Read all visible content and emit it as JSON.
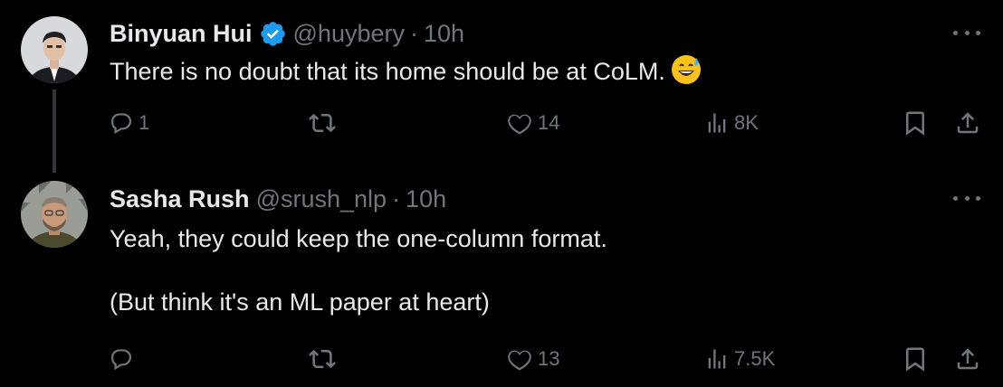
{
  "tweets": [
    {
      "name": "Binyuan Hui",
      "verified": true,
      "handle": "@huybery",
      "separator": "·",
      "time": "10h",
      "text": "There is no doubt that its home should be at CoLM.",
      "emoji": "grinning-face-with-sweat",
      "stats": {
        "replies": "1",
        "retweets": "",
        "likes": "14",
        "views": "8K"
      }
    },
    {
      "name": "Sasha Rush",
      "verified": false,
      "handle": "@srush_nlp",
      "separator": "·",
      "time": "10h",
      "text_line1": "Yeah, they could keep the one-column format.",
      "text_line2": "(But think it's an ML paper at heart)",
      "stats": {
        "replies": "",
        "retweets": "",
        "likes": "13",
        "views": "7.5K"
      }
    }
  ],
  "colors": {
    "background": "#000000",
    "text": "#e7e9ea",
    "secondary": "#71767b",
    "verified": "#1d9bf0",
    "thread_line": "#333639"
  }
}
